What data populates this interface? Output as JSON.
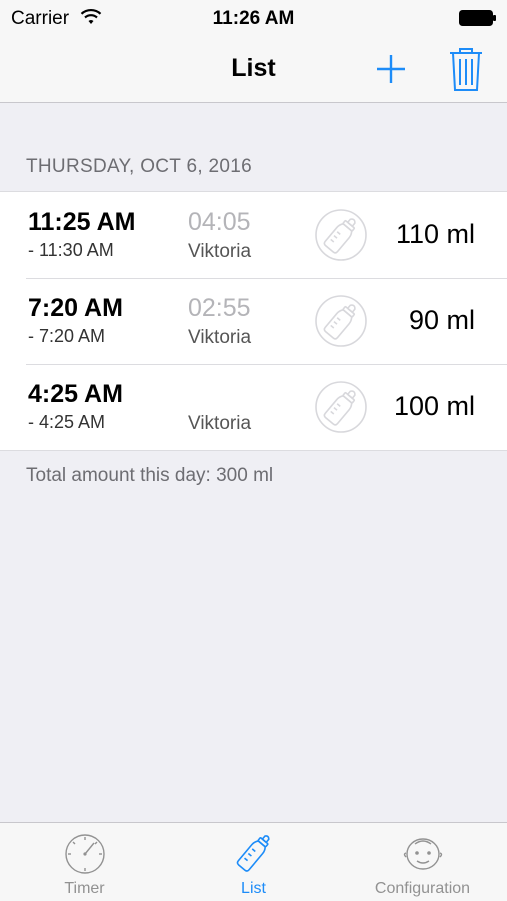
{
  "status_bar": {
    "carrier": "Carrier",
    "time": "11:26 AM"
  },
  "nav": {
    "title": "List",
    "add_icon": "plus-icon",
    "delete_icon": "trash-icon",
    "accent_color": "#1d8cf8"
  },
  "section": {
    "header": "THURSDAY, OCT 6, 2016",
    "total": "Total amount this day: 300 ml",
    "rows": [
      {
        "start": "11:25 AM",
        "end": "- 11:30 AM",
        "duration": "04:05",
        "person": "Viktoria",
        "icon": "bottle-icon",
        "amount": "110 ml"
      },
      {
        "start": "7:20 AM",
        "end": "- 7:20 AM",
        "duration": "02:55",
        "person": "Viktoria",
        "icon": "bottle-icon",
        "amount": "90 ml"
      },
      {
        "start": "4:25 AM",
        "end": "- 4:25 AM",
        "duration": "",
        "person": "Viktoria",
        "icon": "bottle-icon",
        "amount": "100 ml"
      }
    ]
  },
  "tabs": [
    {
      "label": "Timer",
      "icon": "stopwatch-icon",
      "active": false
    },
    {
      "label": "List",
      "icon": "bottle-icon",
      "active": true
    },
    {
      "label": "Configuration",
      "icon": "baby-face-icon",
      "active": false
    }
  ]
}
